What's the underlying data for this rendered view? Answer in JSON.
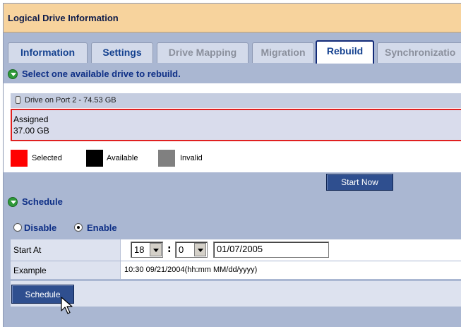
{
  "window": {
    "title": "Logical Drive Information"
  },
  "tabs": [
    {
      "label": "Information",
      "state": "normal"
    },
    {
      "label": "Settings",
      "state": "normal"
    },
    {
      "label": "Drive Mapping",
      "state": "disabled"
    },
    {
      "label": "Migration",
      "state": "disabled"
    },
    {
      "label": "Rebuild",
      "state": "active"
    },
    {
      "label": "Synchronizatio",
      "state": "disabled"
    }
  ],
  "rebuild": {
    "heading": "Select one available drive to rebuild.",
    "drive": {
      "label": "Drive on Port 2 - 74.53 GB",
      "status": "Assigned",
      "size": "37.00 GB"
    },
    "legend": [
      {
        "label": "Selected",
        "color": "#ff0000"
      },
      {
        "label": "Available",
        "color": "#000000"
      },
      {
        "label": "Invalid",
        "color": "#808080"
      }
    ],
    "start_now_label": "Start Now"
  },
  "schedule": {
    "heading": "Schedule",
    "disable_label": "Disable",
    "enable_label": "Enable",
    "selected": "enable",
    "start_at_label": "Start At",
    "hour": "18",
    "minute": "0",
    "separator": ":",
    "date": "01/07/2005",
    "example_label": "Example",
    "example_value": "10:30 09/21/2004(hh:mm MM/dd/yyyy)",
    "button_label": "Schedule"
  },
  "colors": {
    "title_bg": "#f7d39d",
    "page_bg": "#aab7d2",
    "accent_text": "#0e2f86",
    "button_bg": "#2f4f8f"
  }
}
